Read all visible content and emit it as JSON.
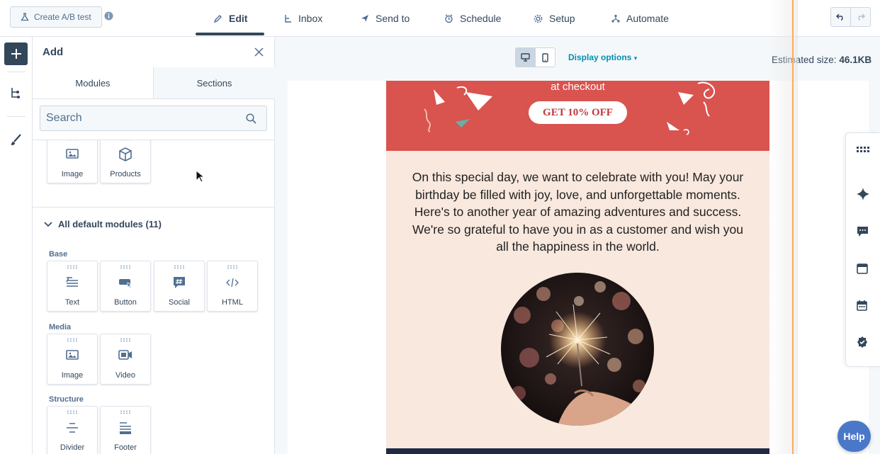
{
  "topbar": {
    "ab_test_label": "Create A/B test",
    "tabs": [
      {
        "label": "Edit",
        "icon": "pencil-icon",
        "active": true
      },
      {
        "label": "Inbox",
        "icon": "inbox-icon",
        "active": false
      },
      {
        "label": "Send to",
        "icon": "send-icon",
        "active": false
      },
      {
        "label": "Schedule",
        "icon": "schedule-icon",
        "active": false
      },
      {
        "label": "Setup",
        "icon": "gear-icon",
        "active": false
      },
      {
        "label": "Automate",
        "icon": "automate-icon",
        "active": false
      }
    ]
  },
  "panel": {
    "title": "Add",
    "tabs": {
      "modules": "Modules",
      "sections": "Sections"
    },
    "search_placeholder": "Search",
    "recent_modules": [
      "Image",
      "Products"
    ],
    "group_title": "All default modules (11)",
    "groups": [
      {
        "name": "Base",
        "modules": [
          "Text",
          "Button",
          "Social",
          "HTML"
        ]
      },
      {
        "name": "Media",
        "modules": [
          "Image",
          "Video"
        ]
      },
      {
        "name": "Structure",
        "modules": [
          "Divider",
          "Footer"
        ]
      }
    ]
  },
  "canvas": {
    "display_options": "Display options",
    "estimated_size_label": "Estimated size:",
    "estimated_size_value": "46.1KB"
  },
  "email": {
    "checkout_text": "at checkout",
    "cta_label": "GET 10% OFF",
    "message": "On this special day, we want to celebrate with you! May your birthday be filled with joy, love, and unforgettable moments. Here's to another year of amazing adventures and success. We're so grateful to have you in as a customer and wish you all the happiness in the world."
  },
  "help_label": "Help",
  "colors": {
    "banner": "#d9534f",
    "body": "#f8e8de",
    "accent_link": "#0091ae",
    "help": "#4a78c9"
  }
}
